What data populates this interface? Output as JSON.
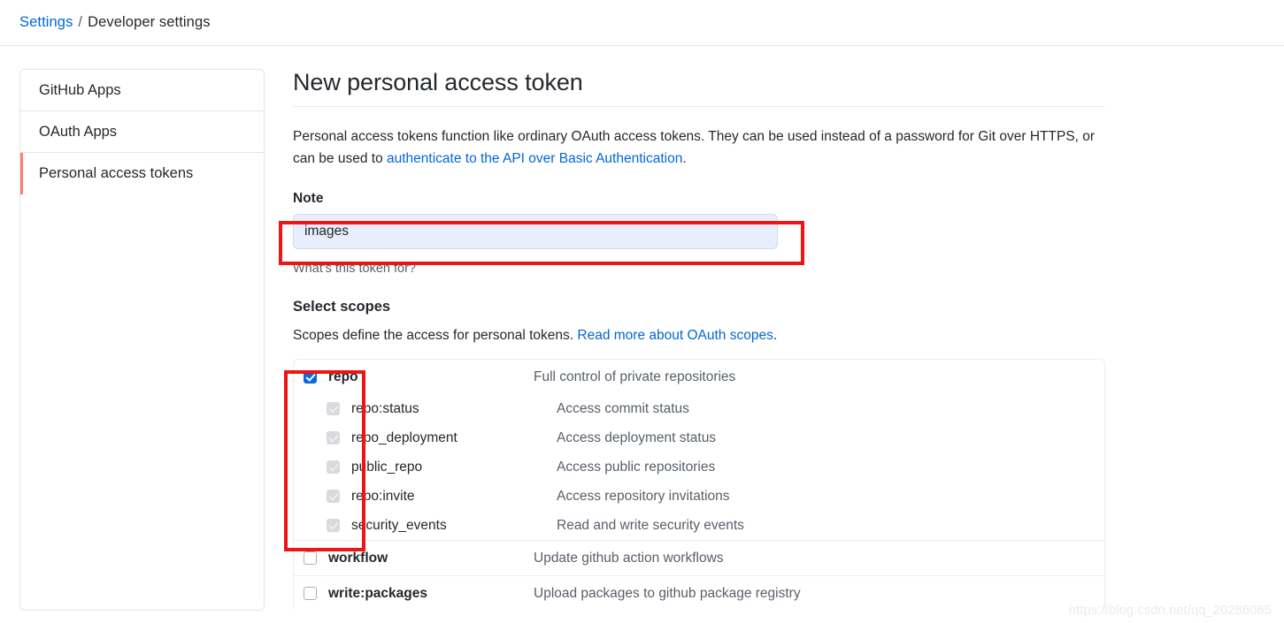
{
  "breadcrumb": {
    "root": "Settings",
    "separator": "/",
    "current": "Developer settings"
  },
  "sidebar": {
    "items": [
      {
        "label": "GitHub Apps",
        "active": false
      },
      {
        "label": "OAuth Apps",
        "active": false
      },
      {
        "label": "Personal access tokens",
        "active": true
      }
    ]
  },
  "main": {
    "title": "New personal access token",
    "intro": {
      "text_before": "Personal access tokens function like ordinary OAuth access tokens. They can be used instead of a password for Git over HTTPS, or can be used to ",
      "link_text": "authenticate to the API over Basic Authentication",
      "text_after": "."
    },
    "note": {
      "label": "Note",
      "value": "images",
      "placeholder": "What's this token for?",
      "helper": "What's this token for?"
    },
    "scopes": {
      "title": "Select scopes",
      "subtitle_before": "Scopes define the access for personal tokens. ",
      "subtitle_link": "Read more about OAuth scopes",
      "subtitle_after": ".",
      "groups": [
        {
          "name": "repo",
          "description": "Full control of private repositories",
          "checked": true,
          "disabled": false,
          "children": [
            {
              "name": "repo:status",
              "description": "Access commit status",
              "checked": true,
              "disabled": true
            },
            {
              "name": "repo_deployment",
              "description": "Access deployment status",
              "checked": true,
              "disabled": true
            },
            {
              "name": "public_repo",
              "description": "Access public repositories",
              "checked": true,
              "disabled": true
            },
            {
              "name": "repo:invite",
              "description": "Access repository invitations",
              "checked": true,
              "disabled": true
            },
            {
              "name": "security_events",
              "description": "Read and write security events",
              "checked": true,
              "disabled": true
            }
          ]
        },
        {
          "name": "workflow",
          "description": "Update github action workflows",
          "checked": false,
          "disabled": false,
          "children": []
        },
        {
          "name": "write:packages",
          "description": "Upload packages to github package registry",
          "checked": false,
          "disabled": false,
          "children": []
        }
      ]
    }
  },
  "annotations": {
    "color": "#ee1515",
    "boxes": [
      {
        "id": "annot-note",
        "target": "note-input"
      },
      {
        "id": "annot-scopes",
        "target": "repo-scope-checkbox-column"
      }
    ]
  },
  "watermark": "https://blog.csdn.net/qq_20286065"
}
